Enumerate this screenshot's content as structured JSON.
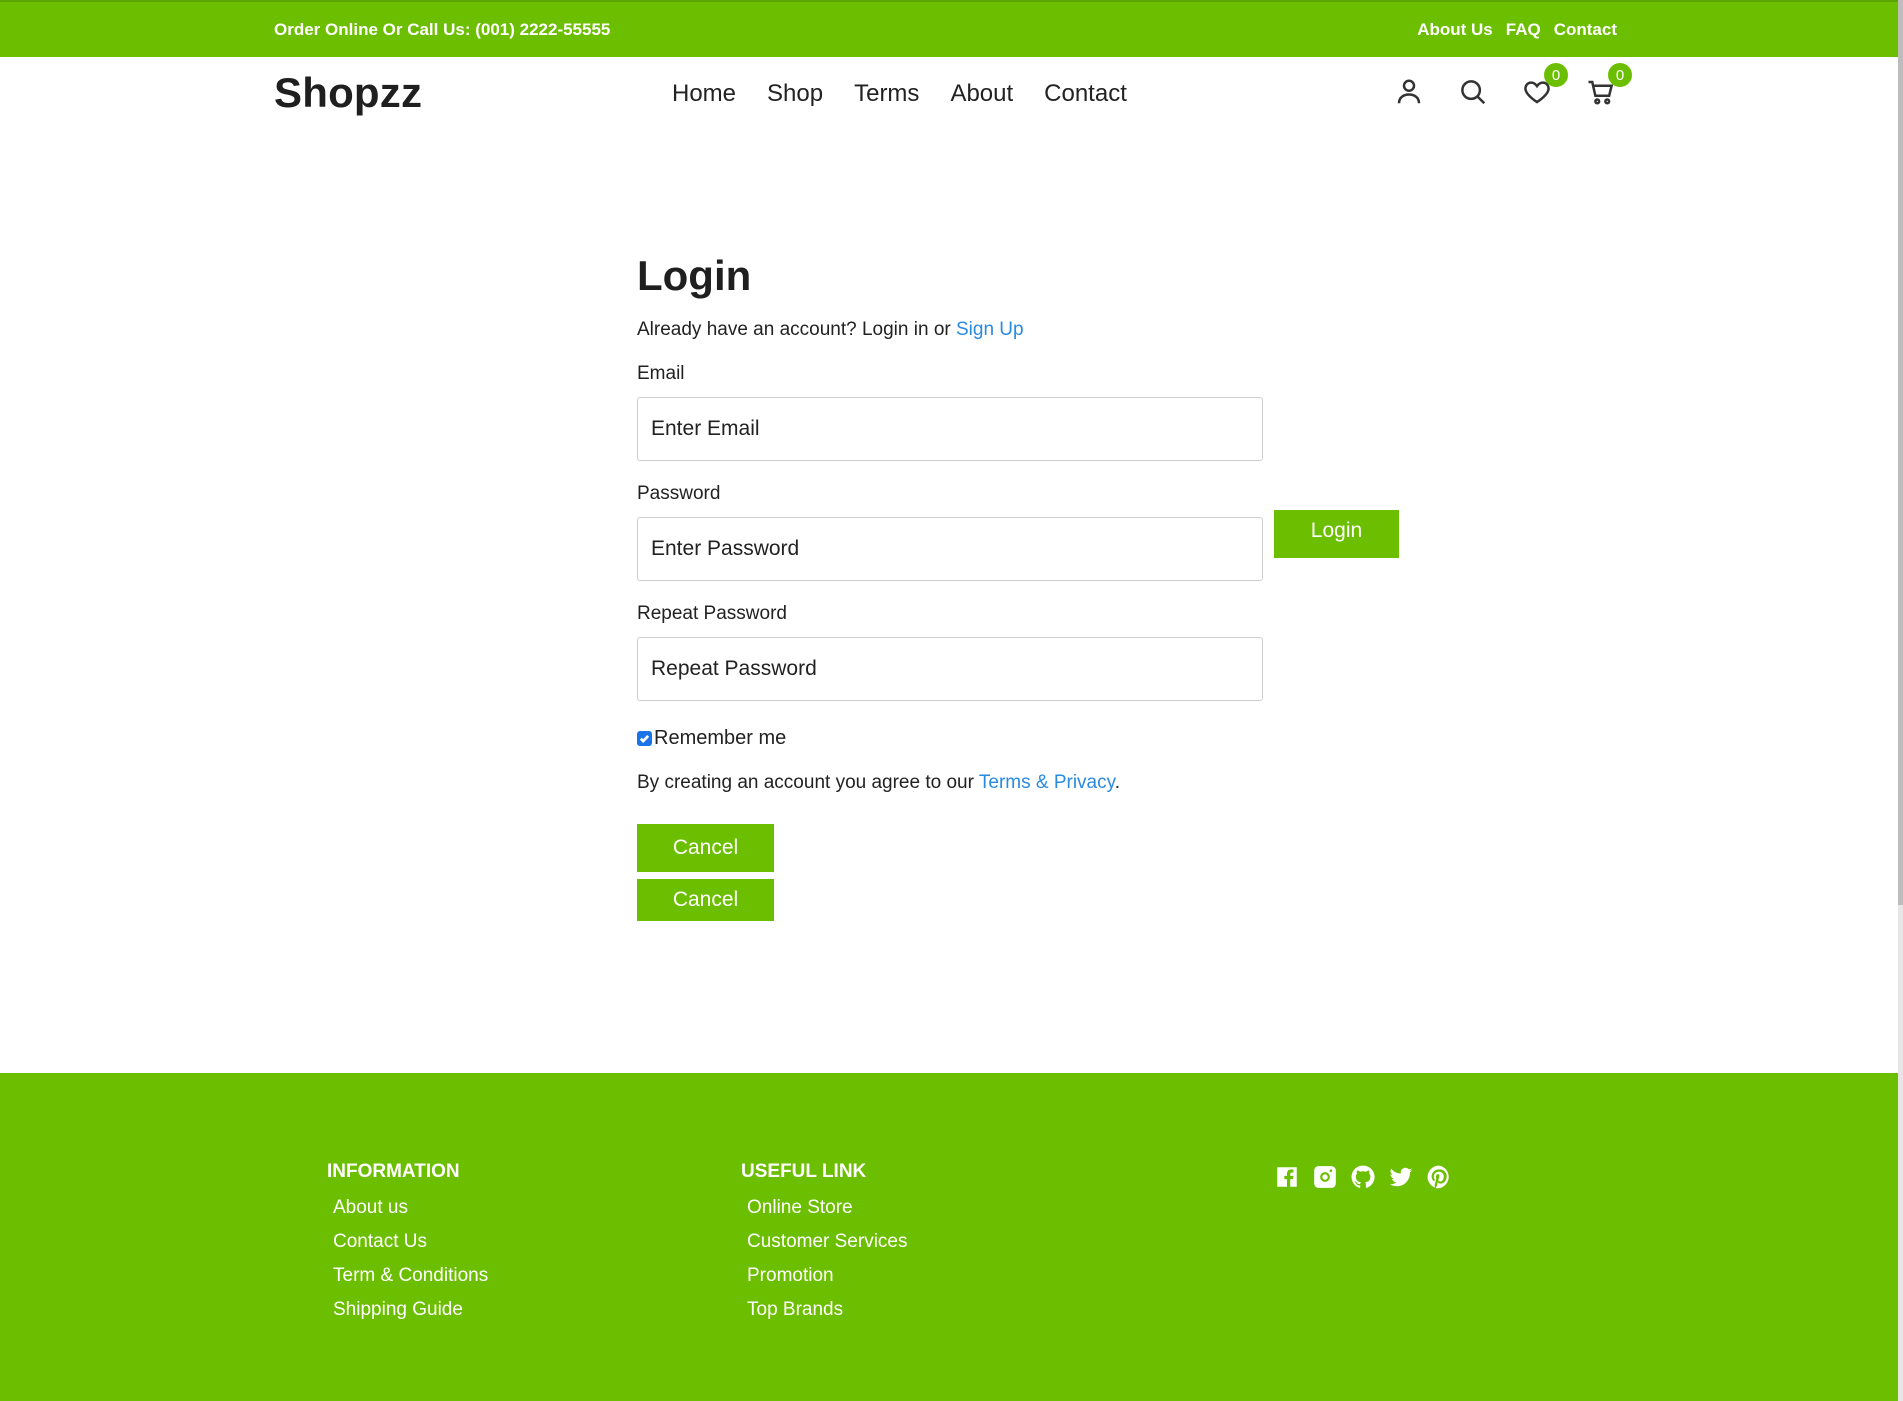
{
  "topbar": {
    "phone": "Order Online Or Call Us: (001) 2222-55555",
    "links": [
      "About Us",
      "FAQ",
      "Contact"
    ]
  },
  "header": {
    "logo": "Shopzz",
    "nav": [
      "Home",
      "Shop",
      "Terms",
      "About",
      "Contact"
    ],
    "wishlist_count": "0",
    "cart_count": "0",
    "icons": [
      "user-icon",
      "search-icon",
      "heart-icon",
      "cart-icon"
    ]
  },
  "login": {
    "title": "Login",
    "lead_text": "Already have an account? Login in or ",
    "signup_link": "Sign Up",
    "email_label": "Email",
    "email_placeholder": "Enter Email",
    "password_label": "Password",
    "password_placeholder": "Enter Password",
    "repeat_label": "Repeat Password",
    "repeat_placeholder": "Repeat Password",
    "remember_label": "Remember me",
    "remember_checked": true,
    "agree_text": "By creating an account you agree to our ",
    "terms_link": "Terms & Privacy",
    "agree_end": ".",
    "cancel_label": "Cancel",
    "login_label": "Login"
  },
  "footer": {
    "information": {
      "title": "INFORMATION",
      "items": [
        "About us",
        "Contact Us",
        "Term & Conditions",
        "Shipping Guide"
      ]
    },
    "useful": {
      "title": "USEFUL LINK",
      "items": [
        "Online Store",
        "Customer Services",
        "Promotion",
        "Top Brands"
      ]
    },
    "social": [
      "facebook-icon",
      "instagram-icon",
      "github-icon",
      "twitter-icon",
      "pinterest-icon"
    ]
  },
  "colors": {
    "brand_green": "#6cbf00",
    "link_blue": "#2a8ae0"
  }
}
